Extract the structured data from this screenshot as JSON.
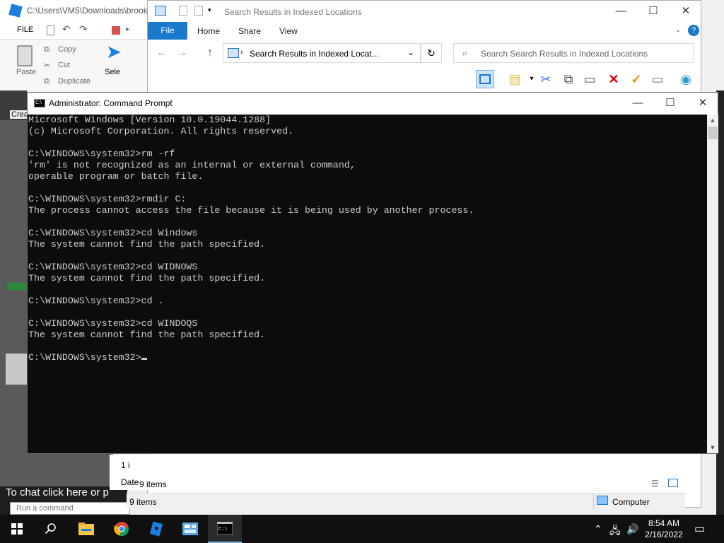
{
  "studio": {
    "path": "C:\\Users\\VM5\\Downloads\\brook",
    "menu_file": "FILE",
    "ribbon": {
      "paste": "Paste",
      "copy": "Copy",
      "cut": "Cut",
      "duplicate": "Duplicate",
      "select": "Sele"
    },
    "crea": "Crea",
    "chat_hint": "To chat click here or p",
    "run_command_placeholder": "Run a command",
    "left_items_count": "1 i",
    "left_date": "Date"
  },
  "explorer": {
    "title": "Search Results in Indexed Locations",
    "tabs": [
      "File",
      "Home",
      "Share",
      "View"
    ],
    "address": "Search Results in Indexed Locat...",
    "search_placeholder": "Search Search Results in Indexed Locations",
    "status_items": "9 items",
    "status_items_bottom": "9 items",
    "status_computer": "Computer",
    "accent": "#1979ca"
  },
  "cmd": {
    "title": "Administrator: Command Prompt",
    "lines": [
      "Microsoft Windows [Version 10.0.19044.1288]",
      "(c) Microsoft Corporation. All rights reserved.",
      "",
      "C:\\WINDOWS\\system32>rm -rf",
      "'rm' is not recognized as an internal or external command,",
      "operable program or batch file.",
      "",
      "C:\\WINDOWS\\system32>rmdir C:",
      "The process cannot access the file because it is being used by another process.",
      "",
      "C:\\WINDOWS\\system32>cd Windows",
      "The system cannot find the path specified.",
      "",
      "C:\\WINDOWS\\system32>cd WIDNOWS",
      "The system cannot find the path specified.",
      "",
      "C:\\WINDOWS\\system32>cd .",
      "",
      "C:\\WINDOWS\\system32>cd WINDOQS",
      "The system cannot find the path specified.",
      "",
      "C:\\WINDOWS\\system32>"
    ]
  },
  "taskbar": {
    "icons": [
      "windows-start-icon",
      "search-icon",
      "file-explorer-icon",
      "chrome-icon",
      "roblox-studio-icon",
      "control-panel-icon",
      "command-prompt-icon"
    ],
    "time": "8:54 AM",
    "date": "2/16/2022"
  }
}
